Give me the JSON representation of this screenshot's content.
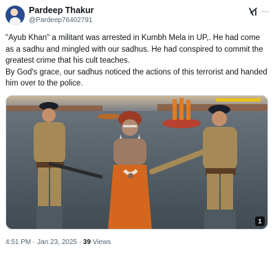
{
  "author": {
    "display_name": "Pardeep Thakur",
    "handle": "@Pardeep76402791"
  },
  "header_icons": [
    "grok-icon",
    "more-icon"
  ],
  "more_label": "···",
  "tweet": {
    "lines": [
      "\"Ayub Khan\" a militant was arrested in Kumbh Mela in UP,. He had come as a sadhu and mingled with our sadhus. He had conspired to commit the greatest crime that his cult teaches.",
      "By God's grace, our sadhus noticed the actions of this terrorist and handed him over to the police."
    ]
  },
  "media": {
    "count_badge": "1"
  },
  "meta": {
    "time": "4:51 PM",
    "date": "Jan 23, 2025",
    "separator": "·",
    "views_count": "39",
    "views_label": "Views"
  },
  "colors": {
    "text": "#0f1419",
    "muted": "#536471",
    "border": "#cfd9de"
  }
}
